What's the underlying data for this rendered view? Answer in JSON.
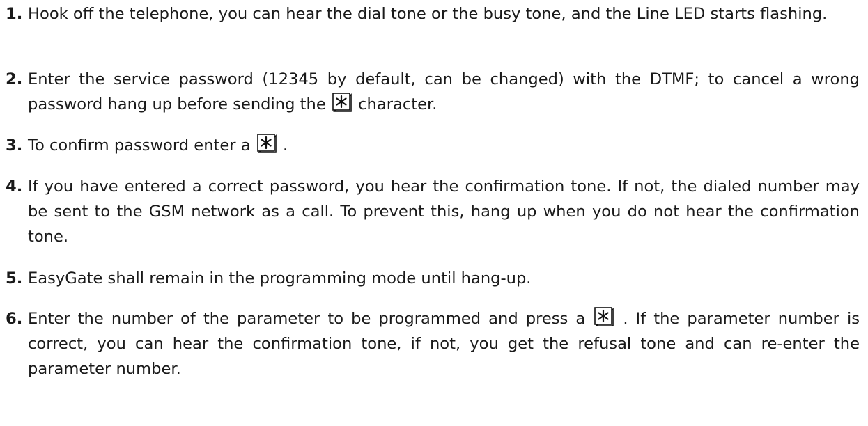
{
  "steps": [
    {
      "number": "1.",
      "text": "Hook off the telephone, you can hear the dial tone or the busy tone, and the Line LED starts flashing."
    },
    {
      "number": "2.",
      "text_a": "Enter the service password (12345 by default, can be changed) with the DTMF; to cancel a wrong password hang up before sending the",
      "text_b": " character."
    },
    {
      "number": "3.",
      "text_a": "To confirm password enter a",
      "text_b": " ."
    },
    {
      "number": "4.",
      "text": "If you have entered a correct password, you hear the confirmation tone. If not, the dialed number may be sent to the GSM network as a call. To prevent this, hang up when you do not hear the confirmation tone."
    },
    {
      "number": "5.",
      "text": "EasyGate shall remain in the programming mode until hang-up."
    },
    {
      "number": "6.",
      "text_a": "Enter the number of the parameter to be programmed and press a",
      "text_b": " . If the parameter number is correct, you can hear the confirmation tone, if not, you get the refusal tone and can re-enter the parameter number."
    }
  ],
  "icons": {
    "star_key": "star-key-icon"
  }
}
